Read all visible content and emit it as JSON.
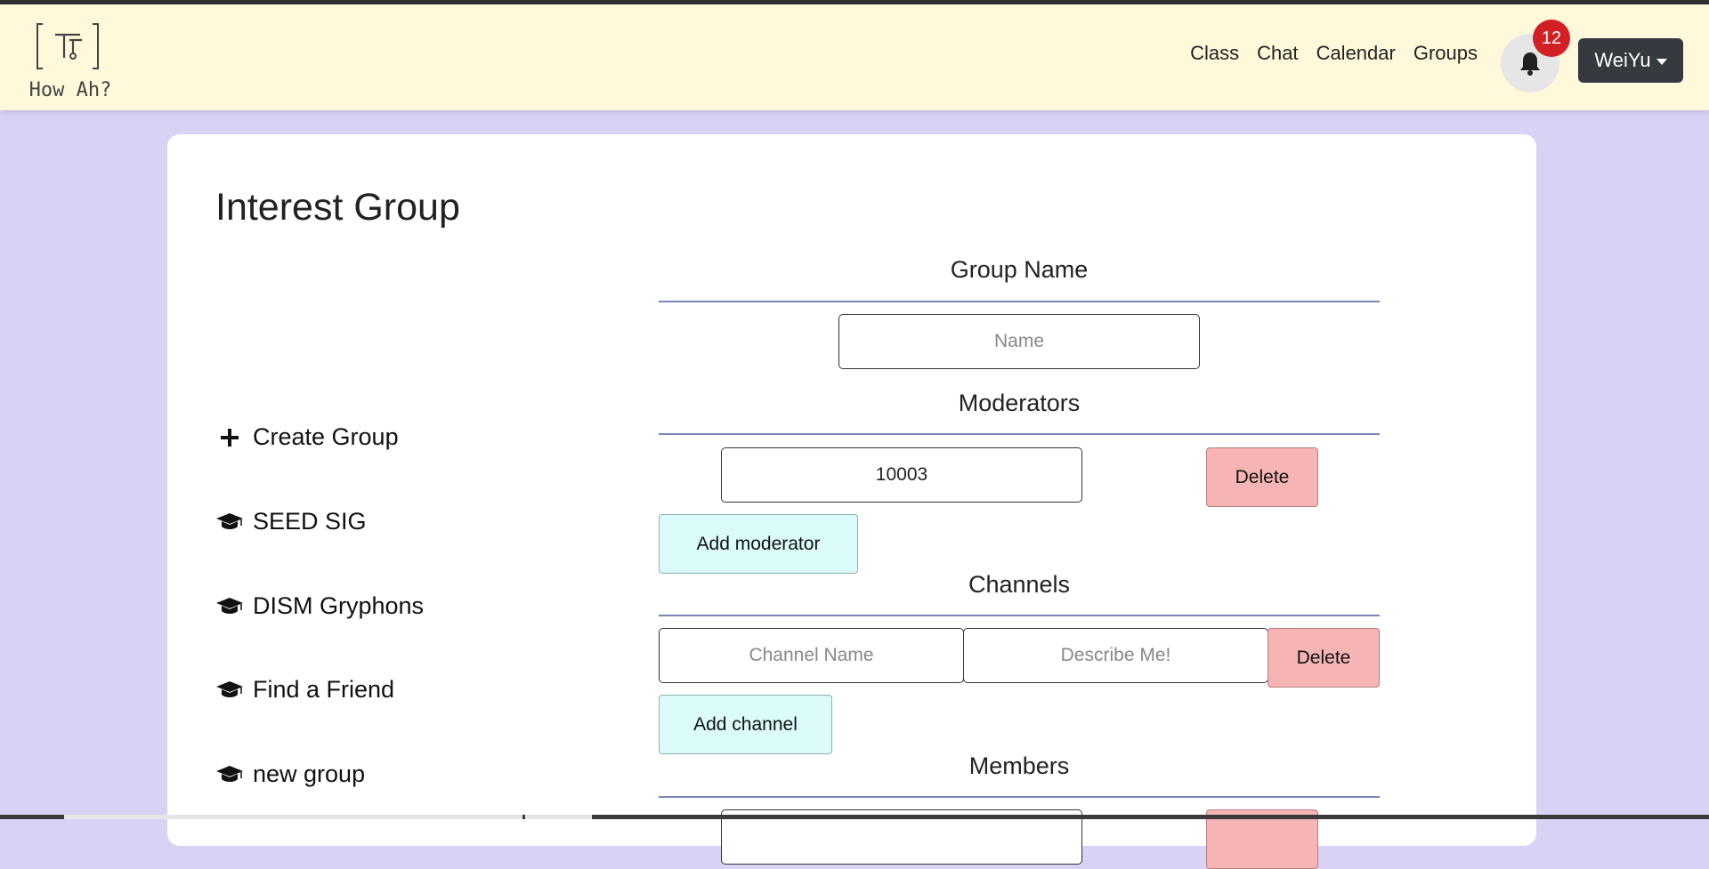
{
  "brand": {
    "name": "How Ah?"
  },
  "nav": {
    "links": [
      "Class",
      "Chat",
      "Calendar",
      "Groups"
    ],
    "notification_count": "12",
    "user": "WeiYu"
  },
  "page": {
    "title": "Interest Group"
  },
  "sidebar": {
    "create_label": "Create Group",
    "groups": [
      "SEED SIG",
      "DISM Gryphons",
      "Find a Friend",
      "new group"
    ]
  },
  "form": {
    "group_name": {
      "title": "Group Name",
      "placeholder": "Name",
      "value": ""
    },
    "moderators": {
      "title": "Moderators",
      "value": "10003",
      "delete_label": "Delete",
      "add_label": "Add moderator"
    },
    "channels": {
      "title": "Channels",
      "name_placeholder": "Channel Name",
      "desc_placeholder": "Describe Me!",
      "delete_label": "Delete",
      "add_label": "Add channel"
    },
    "members": {
      "title": "Members"
    }
  },
  "colors": {
    "background": "#d8d2f5",
    "navbar": "#fff8db",
    "delete": "#f6b4b4",
    "add": "#dcfbfb",
    "badge": "#d32024",
    "user_button": "#343a40"
  }
}
